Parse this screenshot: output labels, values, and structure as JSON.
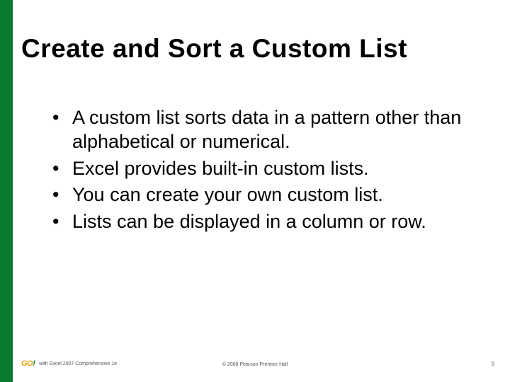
{
  "title": "Create and Sort a Custom List",
  "bullets": [
    "A custom list sorts data in a pattern other than alphabetical or numerical.",
    "Excel provides built-in custom lists.",
    "You can create your own custom list.",
    "Lists can be displayed in a column or row."
  ],
  "footer": {
    "logo_text": "GO!",
    "left": "with Excel 2007 Comprehensive 1e",
    "center": "© 2008 Pearson Prentice Hall",
    "page": "9"
  },
  "colors": {
    "accent_green": "#0a7a2f",
    "logo_orange": "#f59e0b"
  }
}
